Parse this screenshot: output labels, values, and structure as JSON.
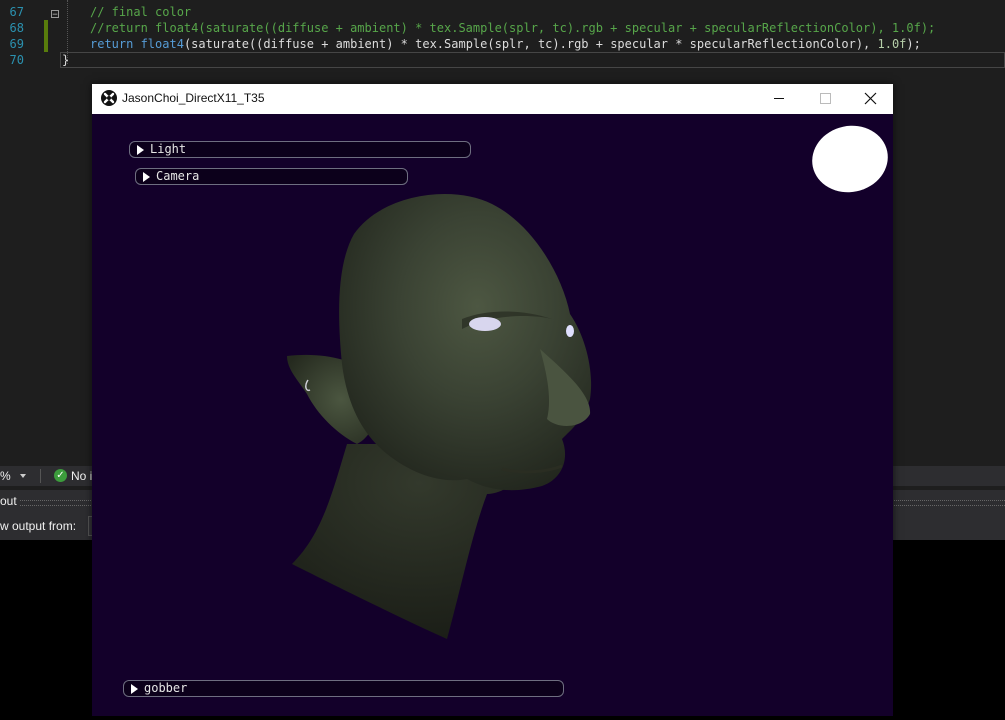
{
  "editor": {
    "lines": [
      {
        "num": "67",
        "parts": [
          {
            "t": "// final color",
            "c": "c-comment"
          }
        ]
      },
      {
        "num": "68",
        "parts": [
          {
            "t": "//return float4(saturate((diffuse + ambient) * tex.Sample(splr, tc).rgb + specular + specularReflectionColor), 1.0f);",
            "c": "c-comment"
          }
        ]
      },
      {
        "num": "69",
        "parts": [
          {
            "t": "return ",
            "c": "c-kw"
          },
          {
            "t": "float4",
            "c": "c-kw"
          },
          {
            "t": "(saturate((diffuse + ambient) * tex.Sample(splr, tc).rgb + specular * specularReflectionColor), ",
            "c": "c-txt"
          },
          {
            "t": "1.0f",
            "c": "c-num"
          },
          {
            "t": ");",
            "c": "c-txt"
          }
        ]
      },
      {
        "num": "70",
        "parts": [
          {
            "t": "}",
            "c": "c-txt"
          }
        ]
      }
    ]
  },
  "status": {
    "zoom": "%",
    "issues": "No i"
  },
  "output": {
    "title": "out",
    "show_output_from": "w output from:"
  },
  "window": {
    "title": "JasonChoi_DirectX11_T35",
    "minimize": "—",
    "maximize": "☐",
    "close": "✕"
  },
  "imgui": {
    "light": "Light",
    "camera": "Camera",
    "model": "gobber"
  },
  "colors": {
    "viewport_bg": "#13002a",
    "editor_bg": "#1e1e1e",
    "comment": "#57a64a",
    "keyword": "#569cd6"
  }
}
